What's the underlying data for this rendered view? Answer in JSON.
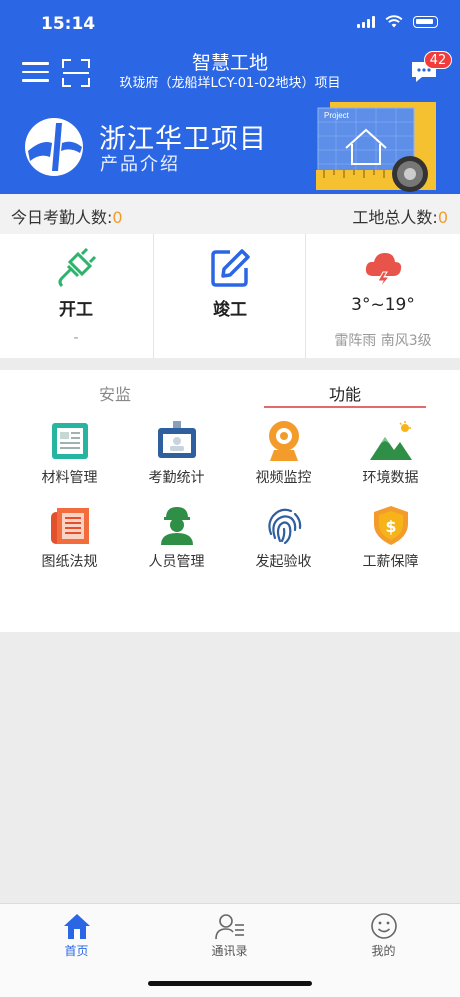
{
  "status_bar": {
    "time": "15:14"
  },
  "header": {
    "title": "智慧工地",
    "subtitle": "玖珑府（龙船垟LCY-01-02地块）项目",
    "message_badge": "42"
  },
  "banner": {
    "title": "浙江华卫项目",
    "subtitle": "产品介绍",
    "art_text": "Project"
  },
  "stats": {
    "today_attendance_label": "今日考勤人数:",
    "today_attendance_value": "0",
    "site_total_label": "工地总人数:",
    "site_total_value": "0"
  },
  "status_cells": [
    {
      "label": "开工",
      "sub": "-",
      "icon": "plug-icon"
    },
    {
      "label": "竣工",
      "sub": "",
      "icon": "edit-icon"
    },
    {
      "label": "3°~19°",
      "sub": "雷阵雨 南风3级",
      "icon": "thunderstorm-icon"
    }
  ],
  "tabs": [
    {
      "label": "安监",
      "active": false
    },
    {
      "label": "功能",
      "active": true
    }
  ],
  "grid": [
    {
      "label": "材料管理",
      "icon": "document-board-icon"
    },
    {
      "label": "考勤统计",
      "icon": "id-badge-icon"
    },
    {
      "label": "视频监控",
      "icon": "webcam-icon"
    },
    {
      "label": "环境数据",
      "icon": "mountain-sun-icon"
    },
    {
      "label": "图纸法规",
      "icon": "blueprint-icon"
    },
    {
      "label": "人员管理",
      "icon": "worker-helmet-icon"
    },
    {
      "label": "发起验收",
      "icon": "fingerprint-icon"
    },
    {
      "label": "工薪保障",
      "icon": "salary-shield-icon"
    }
  ],
  "bottom_nav": [
    {
      "label": "首页",
      "icon": "home-icon",
      "active": true
    },
    {
      "label": "通讯录",
      "icon": "contacts-icon",
      "active": false
    },
    {
      "label": "我的",
      "icon": "smiley-icon",
      "active": false
    }
  ],
  "colors": {
    "primary": "#2b66e4",
    "accent": "#f39c2b",
    "tab_underline": "#e36a6a"
  }
}
